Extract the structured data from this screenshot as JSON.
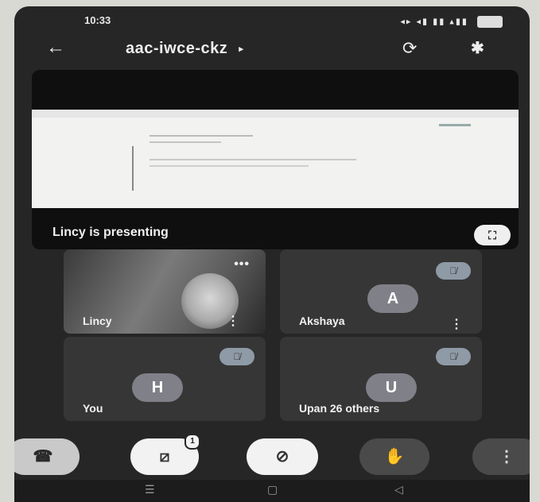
{
  "status_bar": {
    "time": "10:33",
    "icons_text": "◂▸ ◂▮ ▮▮ ▴▮▮"
  },
  "header": {
    "meeting_code": "aac-iwce-ckz",
    "caret": "▸",
    "back_glyph": "←",
    "flip_glyph": "⟳",
    "bluetooth_glyph": "✱"
  },
  "presentation": {
    "label": "Lincy is presenting",
    "fullscreen_glyph": "⛶"
  },
  "tiles": [
    {
      "name": "Lincy",
      "type": "video",
      "menu": "⋮",
      "dots": "•••"
    },
    {
      "name": "Akshaya",
      "initial": "A",
      "menu": "⋮",
      "muted_glyph": "🎙̸"
    },
    {
      "name": "You",
      "initial": "H",
      "muted_glyph": "🎙̸"
    },
    {
      "name": "Upan",
      "initial": "U",
      "others": "26 others",
      "muted_glyph": "🎙̸"
    }
  ],
  "controls": {
    "end_call": "☎",
    "camera_off": "⧄",
    "camera_badge": "1",
    "mic_off": "⊘",
    "raise_hand": "✋",
    "more": "⋮"
  },
  "navbar": {
    "menu": "☰",
    "home": "▢",
    "back": "◁"
  }
}
